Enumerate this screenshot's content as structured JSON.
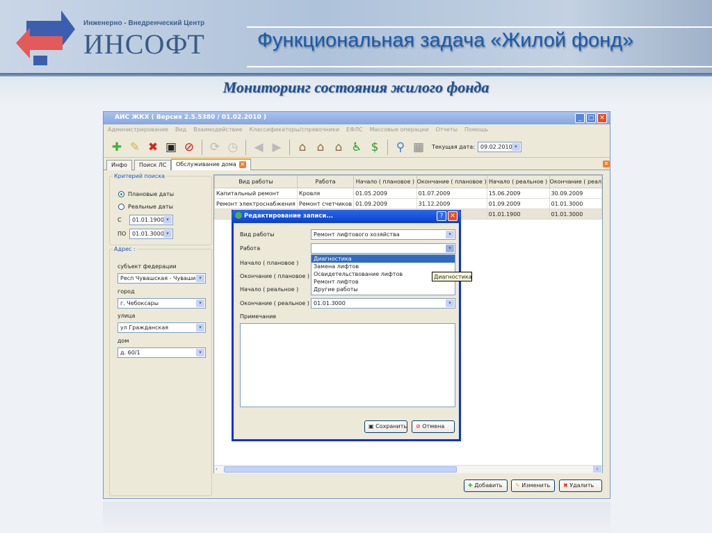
{
  "slide": {
    "logo_tagline": "Инженерно - Внедренческий Центр",
    "logo_name": "ИНСОФТ",
    "title": "Функциональная задача «Жилой фонд»",
    "subtitle": "Мониторинг состояния жилого фонда"
  },
  "window": {
    "title": "АИС ЖКХ ( Версия 2.5.5380 / 01.02.2010 )",
    "menu": [
      "Администрирование",
      "Вид",
      "Взаимодействие",
      "Классификаторы/справочники",
      "ЕФЛС",
      "Массовые операции",
      "Отчеты",
      "Помощь"
    ],
    "toolbar": {
      "date_label": "Текущая дата:",
      "date_value": "09.02.2010"
    },
    "tabs": [
      "Инфо",
      "Поиск ЛС",
      "Обслуживание дома"
    ]
  },
  "criteria": {
    "legend": "Критерий поиска",
    "radio_plan": "Плановые даты",
    "radio_real": "Реальные даты",
    "from_label": "С",
    "from_value": "01.01.1900",
    "to_label": "ПО",
    "to_value": "01.01.3000"
  },
  "address": {
    "legend": "Адрес :",
    "subject_label": "субъект федерации",
    "subject_value": "Респ Чувашская - Чувашия",
    "city_label": "город",
    "city_value": "г. Чебоксары",
    "street_label": "улица",
    "street_value": "ул Гражданская",
    "house_label": "дом",
    "house_value": "д. 60/1"
  },
  "grid": {
    "columns": [
      "Вид работы",
      "Работа",
      "Начало ( плановое )",
      "Окончание ( плановое )",
      "Начало ( реальное )",
      "Окончание ( реал"
    ],
    "rows": [
      [
        "Капитальный ремонт",
        "Кровля",
        "01.05.2009",
        "01.07.2009",
        "15.06.2009",
        "30.09.2009"
      ],
      [
        "Ремонт электроснабжения",
        "Ремонт счетчиков",
        "01.09.2009",
        "31.12.2009",
        "01.09.2009",
        "01.01.3000"
      ],
      [
        "",
        "",
        "",
        "",
        "01.01.1900",
        "01.01.3000"
      ]
    ]
  },
  "actions": {
    "add": "Добавить",
    "edit": "Изменить",
    "delete": "Удалить"
  },
  "dialog": {
    "title": "Редактирование записи...",
    "work_type_label": "Вид работы",
    "work_type_value": "Ремонт лифтового хозяйства",
    "work_label": "Работа",
    "start_plan_label": "Начало ( плановое )",
    "end_plan_label": "Окончание ( плановое )",
    "start_real_label": "Начало ( реальное )",
    "end_real_label": "Окончание ( реальное )",
    "end_real_value": "01.01.3000",
    "note_label": "Примечание",
    "options": [
      "Диагностика",
      "Замена лифтов",
      "Освидетельствование лифтов",
      "Ремонт лифтов",
      "Другие работы"
    ],
    "tooltip": "Диагностика",
    "save": "Сохранить",
    "cancel": "Отмена"
  }
}
